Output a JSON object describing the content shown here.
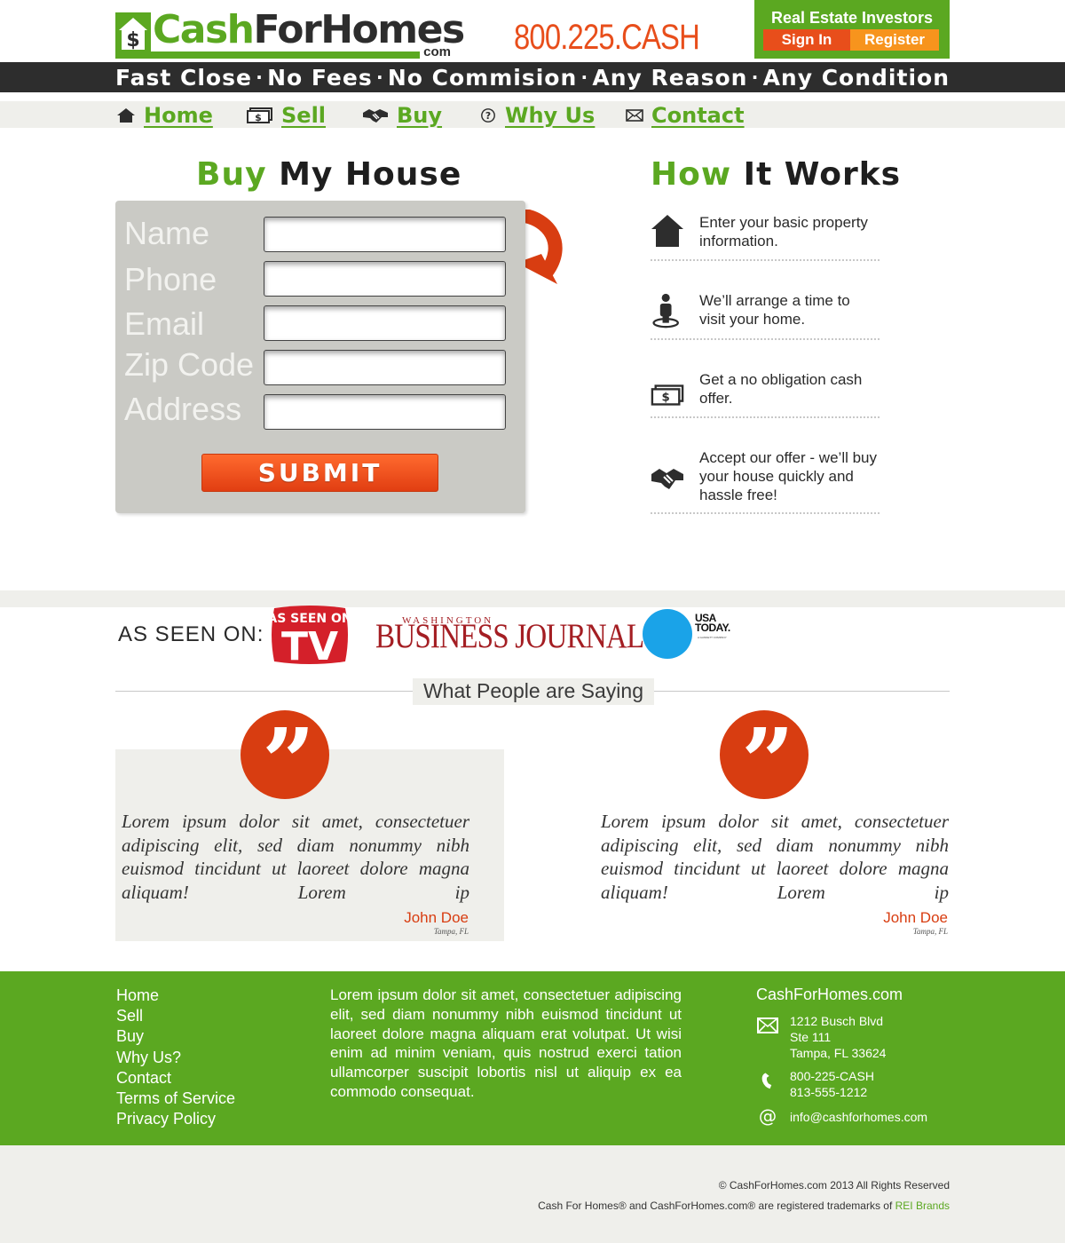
{
  "brand": {
    "logo_cash": "Cash",
    "logo_rest": "ForHomes",
    "logo_com": "com",
    "phone": "800.225.CASH"
  },
  "investors": {
    "title": "Real Estate Investors",
    "sign_in": "Sign In",
    "register": "Register"
  },
  "tagline": [
    "Fast Close",
    "No Fees",
    "No Commision",
    "Any Reason",
    "Any Condition"
  ],
  "tagline_separator": "·",
  "nav": {
    "items": [
      {
        "label": "Home",
        "icon": "house-icon"
      },
      {
        "label": "Sell",
        "icon": "cash-icon"
      },
      {
        "label": "Buy",
        "icon": "handshake-icon"
      },
      {
        "label": "Why Us",
        "icon": "question-circle-icon"
      },
      {
        "label": "Contact",
        "icon": "envelope-icon"
      }
    ]
  },
  "buy_form": {
    "title_highlight": "Buy",
    "title_rest": "My House",
    "fields": [
      {
        "label": "Name",
        "value": ""
      },
      {
        "label": "Phone",
        "value": ""
      },
      {
        "label": "Email",
        "value": ""
      },
      {
        "label": "Zip Code",
        "value": ""
      },
      {
        "label": "Address",
        "value": ""
      }
    ],
    "submit": "SUBMIT"
  },
  "how_it_works": {
    "title_highlight": "How",
    "title_rest": "It Works",
    "steps": [
      {
        "icon": "house-icon",
        "text": "Enter your basic property information."
      },
      {
        "icon": "person-location-icon",
        "text": "We’ll arrange a time to visit your home."
      },
      {
        "icon": "cash-icon",
        "text": "Get a no obligation cash offer."
      },
      {
        "icon": "handshake-icon",
        "text": "Accept our offer - we’ll buy your house quickly and hassle free!"
      }
    ]
  },
  "as_seen_on": {
    "label": "AS SEEN ON:",
    "tv_logo_top": "AS SEEN ON",
    "tv_logo_main": "TV",
    "wbj_small": "WASHINGTON",
    "wbj_big": "BUSINESS JOURNAL",
    "usa_today": "USA TODAY.",
    "usa_today_sub": "A GANNETT COMPANY"
  },
  "testimonials": {
    "title": "What People are Saying",
    "items": [
      {
        "quote": "Lorem ipsum dolor sit amet, consectetuer adipiscing elit, sed diam nonummy nibh euismod tincidunt ut laoreet dolore magna aliquam! Lorem ip",
        "name": "John Doe",
        "location": "Tampa, FL"
      },
      {
        "quote": "Lorem ipsum dolor sit amet, consectetuer adipiscing elit, sed diam nonummy nibh euismod tincidunt ut laoreet dolore magna aliquam! Lorem ip",
        "name": "John Doe",
        "location": "Tampa, FL"
      }
    ]
  },
  "footer": {
    "links": [
      "Home",
      "Sell",
      "Buy",
      "Why Us?",
      "Contact",
      "Terms of Service",
      "Privacy Policy"
    ],
    "about": "Lorem ipsum dolor sit amet, consectetuer adipiscing elit, sed diam nonummy nibh euismod tincidunt ut laoreet dolore magna aliquam erat volutpat. Ut wisi enim ad minim veniam, quis nostrud exerci tation ullamcorper suscipit lobortis nisl ut aliquip ex ea commodo consequat.",
    "site": "CashForHomes.com",
    "address": [
      "1212 Busch Blvd",
      "Ste 111",
      "Tampa, FL 33624"
    ],
    "phones": [
      "800-225-CASH",
      "813-555-1212"
    ],
    "email": "info@cashforhomes.com"
  },
  "bottom": {
    "copyright": "© CashForHomes.com 2013 All Rights Reserved",
    "trademark": "Cash For Homes® and CashForHomes.com® are registered trademarks of",
    "trademark_link": "REI Brands"
  },
  "colors": {
    "green": "#5ba821",
    "orange": "#e84e1b",
    "orange_light": "#f7941d",
    "dark": "#2d2d2d",
    "quote_red": "#d83d11",
    "light_gray": "#efefeb",
    "form_gray": "#cacac5",
    "usa_today_blue": "#1aa3e8",
    "wbj_red": "#a41e23"
  }
}
